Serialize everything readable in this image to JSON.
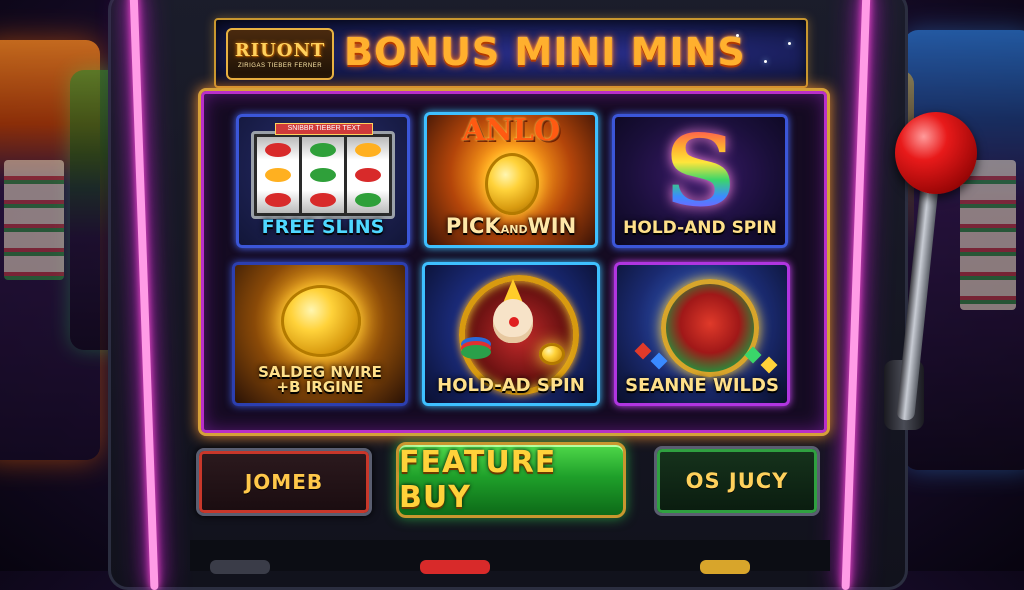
{
  "title": {
    "logo_text": "RIUONT",
    "logo_subtext": "ZIRIGAS TIEBER FERNER",
    "banner_text": "BONUS MINI MINS"
  },
  "features": [
    {
      "id": "free-spins",
      "label": "FREE SLINS",
      "header_text": "SNIBBR TIEBER TEXT"
    },
    {
      "id": "pick-and-win",
      "label_a": "PICK",
      "label_b": "AND",
      "label_c": "WIN",
      "top_text": "ANLO"
    },
    {
      "id": "hold-and-spin-1",
      "label": "HOLD-AND SPIN"
    },
    {
      "id": "salded",
      "label_line1": "SALDEG NVIRE",
      "label_line2": "+B IRGINE"
    },
    {
      "id": "hold-and-spin-2",
      "label": "HOLD-AD SPIN"
    },
    {
      "id": "seanne-wilds",
      "label": "SEANNE WILDS"
    }
  ],
  "buttons": {
    "left": "JOMEB",
    "center": "FEATURE BUY",
    "right": "OS JUCY"
  },
  "colors": {
    "title_gold": "#ffb02e",
    "panel_border": "#d6a13a",
    "neon_pink": "#ff4fd8",
    "feature_buy_green": "#1fa02a"
  }
}
